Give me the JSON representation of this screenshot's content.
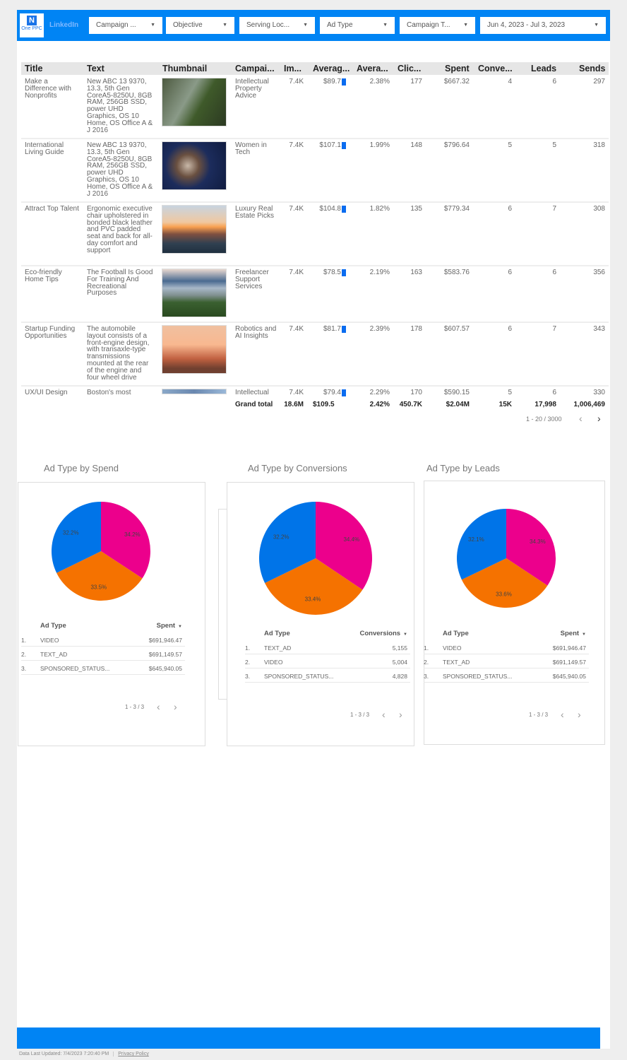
{
  "header": {
    "logo_text": "One PPC",
    "platform": "LinkedIn",
    "filters": [
      "Campaign ...",
      "Objective",
      "Serving Loc...",
      "Ad Type",
      "Campaign T...",
      "Jun 4, 2023 - Jul 3, 2023"
    ]
  },
  "table": {
    "columns": [
      "Title",
      "Text",
      "Thumbnail",
      "Campai...",
      "Im...",
      "Averag...",
      "Avera...",
      "Clic...",
      "Spent",
      "Conve...",
      "Leads",
      "Sends"
    ],
    "rows": [
      {
        "title": "Make a Difference with Nonprofits",
        "text": "New ABC 13 9370, 13.3, 5th Gen CoreA5-8250U, 8GB RAM, 256GB SSD, power UHD Graphics, OS 10 Home, OS Office A & J 2016",
        "thumbnail": "deer-in-stream",
        "campaign": "Intellectual Property Advice",
        "impressions": "7.4K",
        "avg_cpm": "$89.7",
        "avg_ctr": "2.38%",
        "clicks": "177",
        "spent": "$667.32",
        "conversions": "4",
        "leads": "6",
        "sends": "297"
      },
      {
        "title": "International Living Guide",
        "text": "New ABC 13 9370, 13.3, 5th Gen CoreA5-8250U, 8GB RAM, 256GB SSD, power UHD Graphics, OS 10 Home, OS Office A & J 2016",
        "thumbnail": "cats-on-blue-blanket",
        "campaign": "Women in Tech",
        "impressions": "7.4K",
        "avg_cpm": "$107.1",
        "avg_ctr": "1.99%",
        "clicks": "148",
        "spent": "$796.64",
        "conversions": "5",
        "leads": "5",
        "sends": "318"
      },
      {
        "title": "Attract Top Talent",
        "text": "Ergonomic executive chair upholstered in bonded black leather and PVC padded seat and back for all-day comfort and support",
        "thumbnail": "coast-sunset",
        "campaign": "Luxury Real Estate Picks",
        "impressions": "7.4K",
        "avg_cpm": "$104.8",
        "avg_ctr": "1.82%",
        "clicks": "135",
        "spent": "$779.34",
        "conversions": "6",
        "leads": "7",
        "sends": "308"
      },
      {
        "title": "Eco-friendly Home Tips",
        "text": "The Football Is Good For Training And Recreational Purposes",
        "thumbnail": "lake-mountains",
        "campaign": "Freelancer Support Services",
        "impressions": "7.4K",
        "avg_cpm": "$78.5",
        "avg_ctr": "2.19%",
        "clicks": "163",
        "spent": "$583.76",
        "conversions": "6",
        "leads": "6",
        "sends": "356"
      },
      {
        "title": "Startup Funding Opportunities",
        "text": "The automobile layout consists of a front-engine design, with transaxle-type transmissions mounted at the rear of the engine and four wheel drive",
        "thumbnail": "golden-gate-bridge",
        "campaign": "Robotics and AI Insights",
        "impressions": "7.4K",
        "avg_cpm": "$81.7",
        "avg_ctr": "2.39%",
        "clicks": "178",
        "spent": "$607.57",
        "conversions": "6",
        "leads": "7",
        "sends": "343"
      },
      {
        "title": "UX/UI Design",
        "text": "Boston's most",
        "thumbnail": "water",
        "campaign": "Intellectual",
        "impressions": "7.4K",
        "avg_cpm": "$79.4",
        "avg_ctr": "2.29%",
        "clicks": "170",
        "spent": "$590.15",
        "conversions": "5",
        "leads": "6",
        "sends": "330"
      }
    ],
    "grand_total": {
      "label": "Grand total",
      "impressions": "18.6M",
      "avg_cpm": "$109.5",
      "avg_ctr": "2.42%",
      "clicks": "450.7K",
      "spent": "$2.04M",
      "conversions": "15K",
      "leads": "17,998",
      "sends": "1,006,469"
    },
    "pagination": "1 - 20 / 3000"
  },
  "chart_data": [
    {
      "type": "pie",
      "title": "Ad Type by Spend",
      "labels": [
        "VIDEO",
        "TEXT_AD",
        "SPONSORED_STATUS..."
      ],
      "values": [
        34.2,
        33.5,
        32.2
      ],
      "colors": [
        "#ec008c",
        "#f57200",
        "#0074e8"
      ],
      "table": {
        "headers": [
          "Ad Type",
          "Spent"
        ],
        "rows": [
          [
            "1.",
            "VIDEO",
            "$691,946.47"
          ],
          [
            "2.",
            "TEXT_AD",
            "$691,149.57"
          ],
          [
            "3.",
            "SPONSORED_STATUS...",
            "$645,940.05"
          ]
        ],
        "pagination": "1 - 3 / 3"
      }
    },
    {
      "type": "pie",
      "title": "Ad Type by Conversions",
      "labels": [
        "TEXT_AD",
        "VIDEO",
        "SPONSORED_STATUS..."
      ],
      "values": [
        34.4,
        33.4,
        32.2
      ],
      "colors": [
        "#ec008c",
        "#f57200",
        "#0074e8"
      ],
      "table": {
        "headers": [
          "Ad Type",
          "Conversions"
        ],
        "rows": [
          [
            "1.",
            "TEXT_AD",
            "5,155"
          ],
          [
            "2.",
            "VIDEO",
            "5,004"
          ],
          [
            "3.",
            "SPONSORED_STATUS...",
            "4,828"
          ]
        ],
        "pagination": "1 - 3 / 3"
      }
    },
    {
      "type": "pie",
      "title": "Ad Type by Leads",
      "labels": [
        "VIDEO",
        "TEXT_AD",
        "SPONSORED_STATUS..."
      ],
      "values": [
        34.3,
        33.6,
        32.1
      ],
      "colors": [
        "#ec008c",
        "#f57200",
        "#0074e8"
      ],
      "table": {
        "headers": [
          "Ad Type",
          "Spent"
        ],
        "rows": [
          [
            "1.",
            "VIDEO",
            "$691,946.47"
          ],
          [
            "2.",
            "TEXT_AD",
            "$691,149.57"
          ],
          [
            "3.",
            "SPONSORED_STATUS...",
            "$645,940.05"
          ]
        ],
        "pagination": "1 - 3 / 3"
      }
    }
  ],
  "footer": {
    "updated": "Data Last Updated: 7/4/2023 7:20:40 PM",
    "privacy": "Privacy Policy"
  },
  "colors": {
    "header": "#0084f4",
    "bar": "#0a6cf0"
  }
}
